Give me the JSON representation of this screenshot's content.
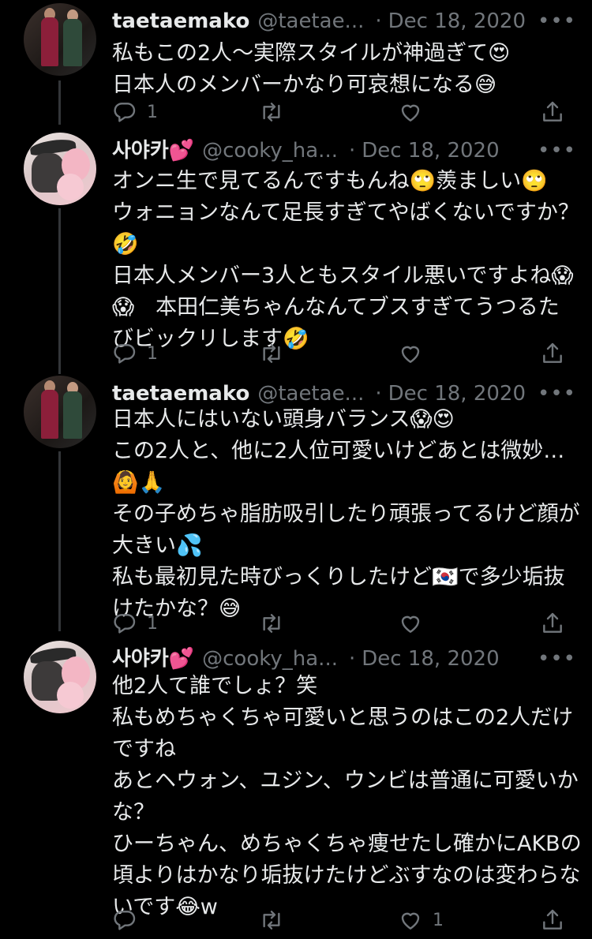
{
  "tweets": [
    {
      "display_name": "taetaemako",
      "handle": "@taetae...",
      "sep": "·",
      "date": "Dec 18, 2020",
      "more": "•••",
      "lines": [
        "私もこの2人〜実際スタイルが神過ぎて😍",
        "日本人のメンバーかなり可哀想になる😅"
      ],
      "replies": "1",
      "retweets": "",
      "likes": ""
    },
    {
      "display_name": "사야카💕",
      "handle": "@cooky_ha...",
      "sep": "·",
      "date": "Dec 18, 2020",
      "more": "•••",
      "lines": [
        "オンニ生で見てるんですもんね🙄羨ましい🙄",
        "ウォニョンなんて足長すぎてやばくないですか？",
        "🤣",
        "日本人メンバー3人ともスタイル悪いですよね😱",
        "😱　本田仁美ちゃんなんてブスすぎてうつるた",
        "びビックリします🤣"
      ],
      "replies": "1",
      "retweets": "",
      "likes": ""
    },
    {
      "display_name": "taetaemako",
      "handle": "@taetae...",
      "sep": "·",
      "date": "Dec 18, 2020",
      "more": "•••",
      "lines": [
        "日本人にはいない頭身バランス😱😍",
        "この2人と、他に2人位可愛いけどあとは微妙…",
        "🙆🙏",
        "その子めちゃ脂肪吸引したり頑張ってるけど顔が",
        "大きい💦",
        "私も最初見た時びっくりしたけど🇰🇷で多少垢抜",
        "けたかな？😅"
      ],
      "replies": "1",
      "retweets": "",
      "likes": ""
    },
    {
      "display_name": "사야카💕",
      "handle": "@cooky_ha...",
      "sep": "·",
      "date": "Dec 18, 2020",
      "more": "•••",
      "lines": [
        "他2人て誰でしょ？笑",
        "私もめちゃくちゃ可愛いと思うのはこの2人だけ",
        "ですね",
        "あとヘウォン、ユジン、ウンビは普通に可愛いか",
        "な？",
        "ひーちゃん、めちゃくちゃ痩せたし確かにAKBの",
        "頃よりはかなり垢抜けたけどぶすなのは変わらな",
        "いです😂w"
      ],
      "replies": "",
      "retweets": "",
      "likes": "1"
    }
  ],
  "icons": {
    "reply": "reply-icon",
    "retweet": "retweet-icon",
    "like": "heart-icon",
    "share": "share-icon"
  },
  "colors": {
    "background": "#000000",
    "text": "#e7e9ea",
    "muted": "#71767b",
    "thread_line": "#333639"
  }
}
